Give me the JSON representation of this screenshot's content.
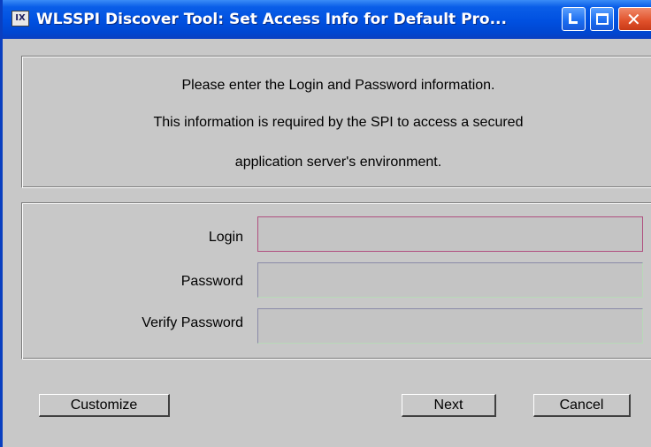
{
  "window": {
    "title": "WLSSPI Discover Tool: Set Access Info for Default Pro...",
    "app_icon_glyph": "IX",
    "controls": {
      "minimize_icon": "minimize-icon",
      "maximize_icon": "maximize-icon",
      "close_icon": "close-icon",
      "close_glyph": "✕"
    },
    "colors": {
      "titlebar": "#0050e0",
      "body": "#c8c8c8",
      "close_button": "#e0502a"
    }
  },
  "info": {
    "line1": "Please enter the Login and Password information.",
    "line2": "This information is required by the SPI to access a secured",
    "line3": "application server's environment."
  },
  "form": {
    "login_label": "Login",
    "login_value": "",
    "password_label": "Password",
    "password_value": "",
    "verify_label": "Verify Password",
    "verify_value": ""
  },
  "buttons": {
    "customize": "Customize",
    "next": "Next",
    "cancel": "Cancel"
  }
}
